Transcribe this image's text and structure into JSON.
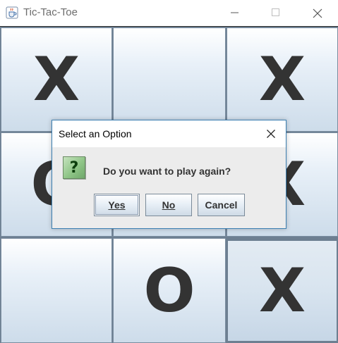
{
  "window": {
    "title": "Tic-Tac-Toe",
    "icons": {
      "app": "java-coffee-icon",
      "minimize": "minimize-icon",
      "maximize": "maximize-icon",
      "close": "close-icon"
    }
  },
  "board": {
    "cells": [
      "X",
      "",
      "X",
      "O",
      "",
      "X",
      "",
      "O",
      "X"
    ]
  },
  "dialog": {
    "title": "Select an Option",
    "icon": "question-icon",
    "icon_glyph": "?",
    "message": "Do you want to play again?",
    "buttons": {
      "yes": "Yes",
      "no": "No",
      "cancel": "Cancel"
    },
    "close_icon": "close-icon"
  },
  "colors": {
    "board_frame": "#6d7f91",
    "mark": "#333333",
    "dialog_border": "#3c7fb1",
    "question_icon_bg": "#8fc587"
  }
}
